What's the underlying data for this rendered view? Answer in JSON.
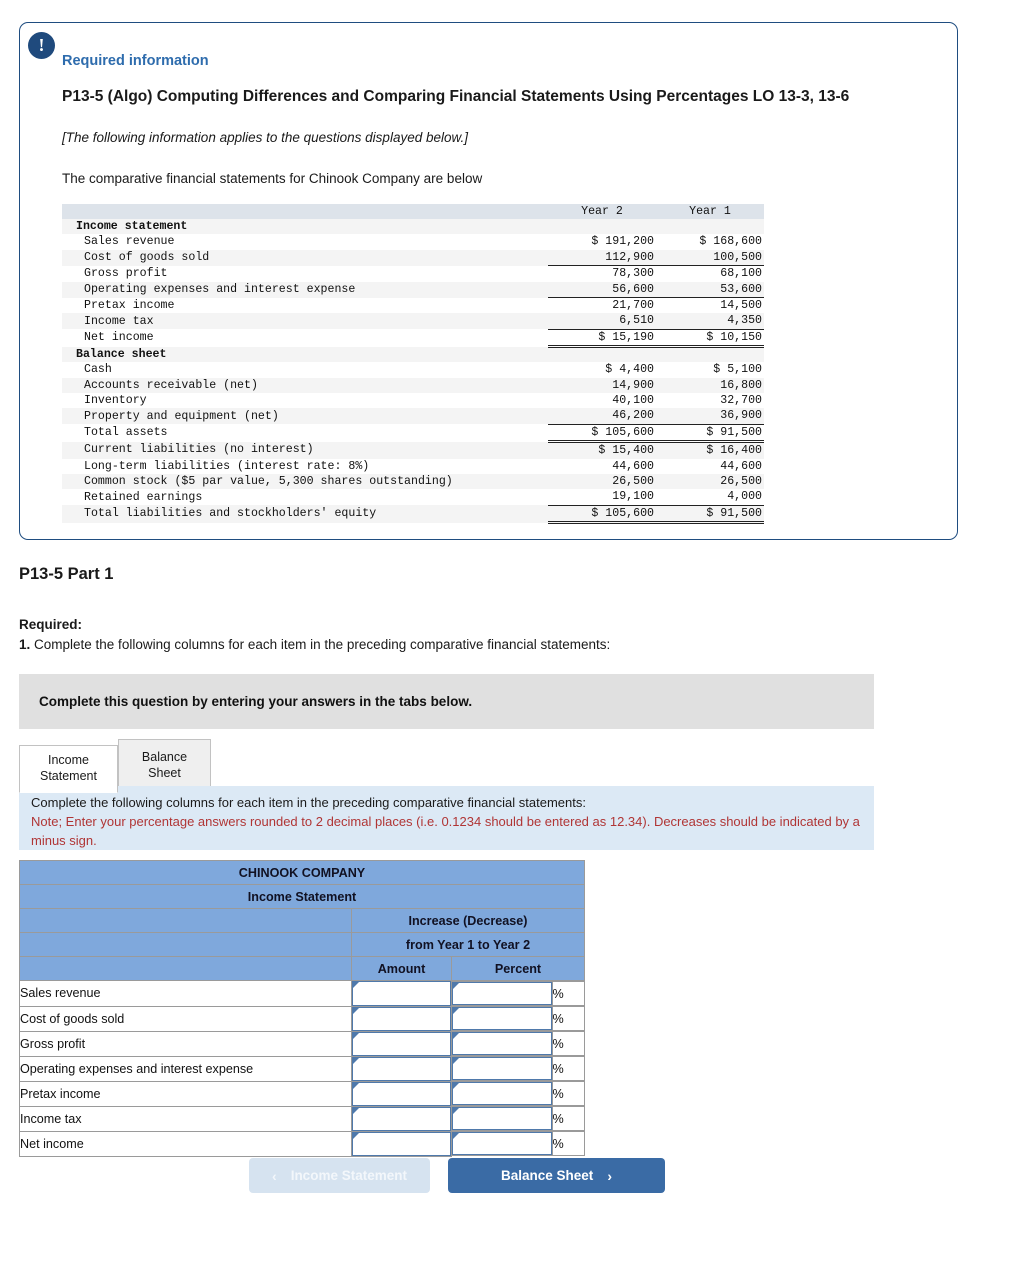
{
  "card": {
    "icon": "exclamation-icon",
    "required_label": "Required information",
    "problem_title": "P13-5 (Algo) Computing Differences and Comparing Financial Statements Using Percentages LO 13-3, 13-6",
    "applies_note": "[The following information applies to the questions displayed below.]",
    "intro": "The comparative financial statements for Chinook Company are below"
  },
  "fin_table": {
    "col_headers": [
      "",
      "Year 2",
      "Year 1"
    ],
    "rows": [
      {
        "label": "Income statement",
        "bold": true,
        "indent": false,
        "y2": "",
        "y1": ""
      },
      {
        "label": "Sales revenue",
        "indent": true,
        "y2": "$ 191,200",
        "y1": "$ 168,600"
      },
      {
        "label": "Cost of goods sold",
        "indent": true,
        "y2": "112,900",
        "y1": "100,500"
      },
      {
        "label": "Gross profit",
        "indent": true,
        "y2": "78,300",
        "y1": "68,100",
        "rule": "top"
      },
      {
        "label": "Operating expenses and interest expense",
        "indent": true,
        "y2": "56,600",
        "y1": "53,600"
      },
      {
        "label": "Pretax income",
        "indent": true,
        "y2": "21,700",
        "y1": "14,500",
        "rule": "top"
      },
      {
        "label": "Income tax",
        "indent": true,
        "y2": "6,510",
        "y1": "4,350"
      },
      {
        "label": "Net income",
        "indent": true,
        "y2": "$ 15,190",
        "y1": "$ 10,150",
        "rule": "topdouble"
      },
      {
        "label": "Balance sheet",
        "bold": true,
        "indent": false,
        "y2": "",
        "y1": ""
      },
      {
        "label": "Cash",
        "indent": true,
        "y2": "$ 4,400",
        "y1": "$ 5,100"
      },
      {
        "label": "Accounts receivable (net)",
        "indent": true,
        "y2": "14,900",
        "y1": "16,800"
      },
      {
        "label": "Inventory",
        "indent": true,
        "y2": "40,100",
        "y1": "32,700"
      },
      {
        "label": "Property and equipment (net)",
        "indent": true,
        "y2": "46,200",
        "y1": "36,900"
      },
      {
        "label": "Total assets",
        "indent": true,
        "y2": "$ 105,600",
        "y1": "$ 91,500",
        "rule": "topdouble"
      },
      {
        "label": "Current liabilities (no interest)",
        "indent": true,
        "y2": "$ 15,400",
        "y1": "$ 16,400"
      },
      {
        "label": "Long-term liabilities (interest rate: 8%)",
        "indent": true,
        "y2": "44,600",
        "y1": "44,600"
      },
      {
        "label": "Common stock ($5 par value, 5,300 shares outstanding)",
        "indent": true,
        "y2": "26,500",
        "y1": "26,500"
      },
      {
        "label": "Retained earnings",
        "indent": true,
        "y2": "19,100",
        "y1": "4,000"
      },
      {
        "label": "Total liabilities and stockholders' equity",
        "indent": true,
        "y2": "$ 105,600",
        "y1": "$ 91,500",
        "rule": "topdouble"
      }
    ]
  },
  "part": {
    "title": "P13-5 Part 1",
    "required_label": "Required:",
    "required_number": "1.",
    "required_text": " Complete the following columns for each item in the preceding comparative financial statements:"
  },
  "banner": {
    "text": "Complete this question by entering your answers in the tabs below."
  },
  "tabs": [
    {
      "label": "Income Statement",
      "line1": "Income",
      "line2": "Statement",
      "active": true
    },
    {
      "label": "Balance Sheet",
      "line1": "Balance Sheet",
      "line2": "",
      "active": false
    }
  ],
  "note": {
    "line1": "Complete the following columns for each item in the preceding comparative financial statements:",
    "line2": "Note; Enter your percentage answers rounded to 2 decimal places (i.e. 0.1234 should be entered as 12.34). Decreases should be indicated by a minus sign."
  },
  "answer_table": {
    "company": "CHINOOK COMPANY",
    "statement": "Income Statement",
    "group_header_line1": "Increase (Decrease)",
    "group_header_line2": "from Year 1 to Year 2",
    "col_amount": "Amount",
    "col_percent": "Percent",
    "percent_symbol": "%",
    "rows": [
      {
        "label": "Sales revenue",
        "amount": "",
        "percent": ""
      },
      {
        "label": "Cost of goods sold",
        "amount": "",
        "percent": ""
      },
      {
        "label": "Gross profit",
        "amount": "",
        "percent": ""
      },
      {
        "label": "Operating expenses and interest expense",
        "amount": "",
        "percent": ""
      },
      {
        "label": "Pretax income",
        "amount": "",
        "percent": ""
      },
      {
        "label": "Income tax",
        "amount": "",
        "percent": ""
      },
      {
        "label": "Net income",
        "amount": "",
        "percent": ""
      }
    ]
  },
  "nav": {
    "prev_label": "Income Statement",
    "next_label": "Balance Sheet",
    "prev_chevron": "‹",
    "next_chevron": "›"
  },
  "colors": {
    "card_border": "#1f4d80",
    "accent_blue": "#2e6cad",
    "table_header_blue": "#7fa8dc",
    "note_bg": "#dce9f5",
    "note_red": "#b03535",
    "banner_gray": "#e0e0e0",
    "next_button": "#3a6ba5",
    "prev_button": "#d6e3f0"
  }
}
